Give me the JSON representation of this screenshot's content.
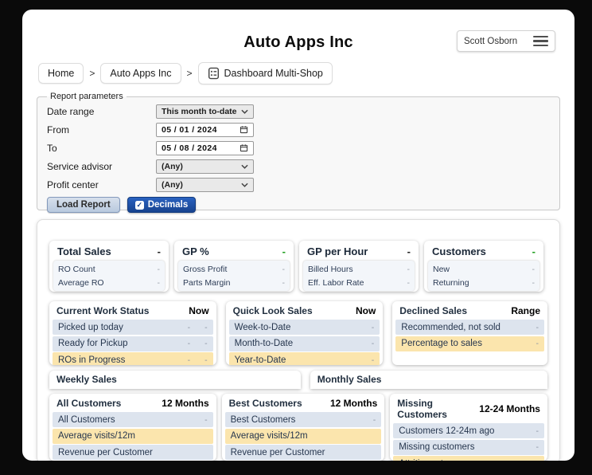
{
  "colors": {
    "accent_blue": "#1d4fa3",
    "highlight_row": "#fbe5ad",
    "normal_row": "#dde4ee",
    "positive_green": "#1e9e1e",
    "background": "#0a0a0a"
  },
  "header": {
    "title": "Auto Apps Inc",
    "user_name": "Scott Osborn"
  },
  "breadcrumb": {
    "home": "Home",
    "separator": ">",
    "company": "Auto Apps Inc",
    "page": "Dashboard Multi-Shop"
  },
  "report_parameters": {
    "legend": "Report parameters",
    "date_range": {
      "label": "Date range",
      "value": "This month to-date"
    },
    "from": {
      "label": "From",
      "value": "05 / 01 / 2024"
    },
    "to": {
      "label": "To",
      "value": "05 / 08 / 2024"
    },
    "service_advisor": {
      "label": "Service advisor",
      "value": "(Any)"
    },
    "profit_center": {
      "label": "Profit center",
      "value": "(Any)"
    },
    "load_button": "Load Report",
    "decimals_button": "Decimals",
    "decimals_check": "✓"
  },
  "metric_cards": [
    {
      "title": "Total Sales",
      "value": "-",
      "rows": [
        {
          "label": "RO Count",
          "value": "-"
        },
        {
          "label": "Average RO",
          "value": "-"
        }
      ]
    },
    {
      "title": "GP %",
      "value": "-",
      "rows": [
        {
          "label": "Gross Profit",
          "value": "-"
        },
        {
          "label": "Parts Margin",
          "value": "-"
        }
      ]
    },
    {
      "title": "GP per Hour",
      "value": "-",
      "rows": [
        {
          "label": "Billed Hours",
          "value": "-"
        },
        {
          "label": "Eff. Labor Rate",
          "value": "-"
        }
      ]
    },
    {
      "title": "Customers",
      "value": "-",
      "rows": [
        {
          "label": "New",
          "value": "-"
        },
        {
          "label": "Returning",
          "value": "-"
        }
      ]
    }
  ],
  "status_cards": [
    {
      "title": "Current Work Status",
      "range": "Now",
      "rows": [
        {
          "label": "Picked up today",
          "value1": "-",
          "value2": "-"
        },
        {
          "label": "Ready for Pickup",
          "value1": "-",
          "value2": "-"
        },
        {
          "label": "ROs in Progress",
          "value1": "-",
          "value2": "-"
        }
      ]
    },
    {
      "title": "Quick Look Sales",
      "range": "Now",
      "rows": [
        {
          "label": "Week-to-Date",
          "value1": "-"
        },
        {
          "label": "Month-to-Date",
          "value1": "-"
        },
        {
          "label": "Year-to-Date",
          "value1": "-"
        }
      ]
    },
    {
      "title": "Declined Sales",
      "range": "Range",
      "rows": [
        {
          "label": "Recommended, not sold",
          "value1": "-"
        },
        {
          "label": "Percentage to sales",
          "value1": "-"
        }
      ]
    }
  ],
  "chart_cards": [
    {
      "title": "Weekly Sales"
    },
    {
      "title": "Monthly Sales"
    }
  ],
  "customer_cards": [
    {
      "title": "All Customers",
      "range": "12 Months",
      "rows": [
        {
          "label": "All Customers",
          "value1": "-"
        },
        {
          "label": "Average visits/12m",
          "value1": ""
        },
        {
          "label": "Revenue per Customer",
          "value1": ""
        }
      ]
    },
    {
      "title": "Best Customers",
      "range": "12 Months",
      "rows": [
        {
          "label": "Best Customers",
          "value1": "-"
        },
        {
          "label": "Average visits/12m",
          "value1": ""
        },
        {
          "label": "Revenue per Customer",
          "value1": ""
        }
      ]
    },
    {
      "title": "Missing Customers",
      "range": "12-24 Months",
      "rows": [
        {
          "label": "Customers 12-24m ago",
          "value1": "-"
        },
        {
          "label": "Missing customers",
          "value1": "-"
        },
        {
          "label": "Attrition rate",
          "value1": "-"
        }
      ]
    }
  ]
}
